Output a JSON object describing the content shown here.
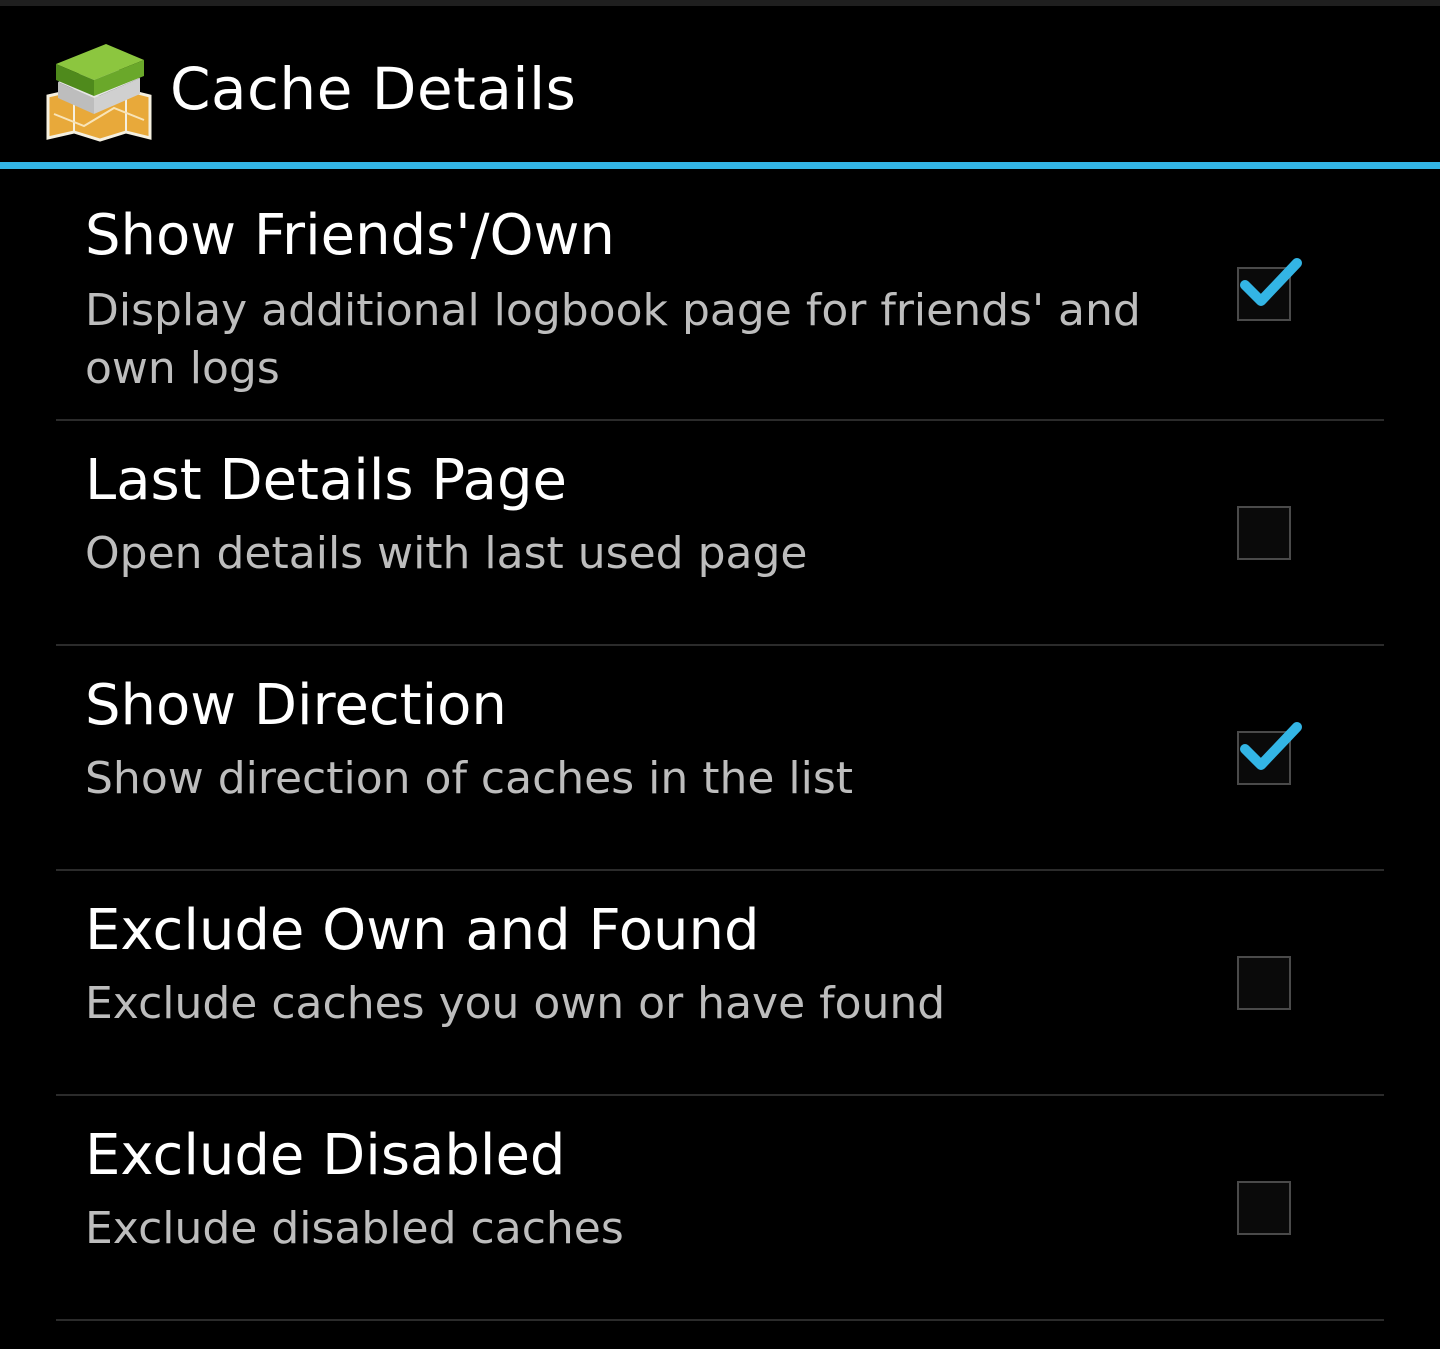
{
  "action_bar": {
    "title": "Cache Details",
    "icon": "cgeo-app-icon"
  },
  "colors": {
    "accent": "#33b5e5",
    "background": "#000000",
    "title_text": "#ffffff",
    "summary_text": "#bdbdbd"
  },
  "preferences": [
    {
      "title": "Show Friends'/Own",
      "summary": "Display additional logbook page for friends' and own logs",
      "checked": true
    },
    {
      "title": "Last Details Page",
      "summary": "Open details with last used page",
      "checked": false
    },
    {
      "title": "Show Direction",
      "summary": "Show direction of caches in the list",
      "checked": true
    },
    {
      "title": "Exclude Own and Found",
      "summary": "Exclude caches you own or have found",
      "checked": false
    },
    {
      "title": "Exclude Disabled",
      "summary": "Exclude disabled caches",
      "checked": false
    }
  ]
}
